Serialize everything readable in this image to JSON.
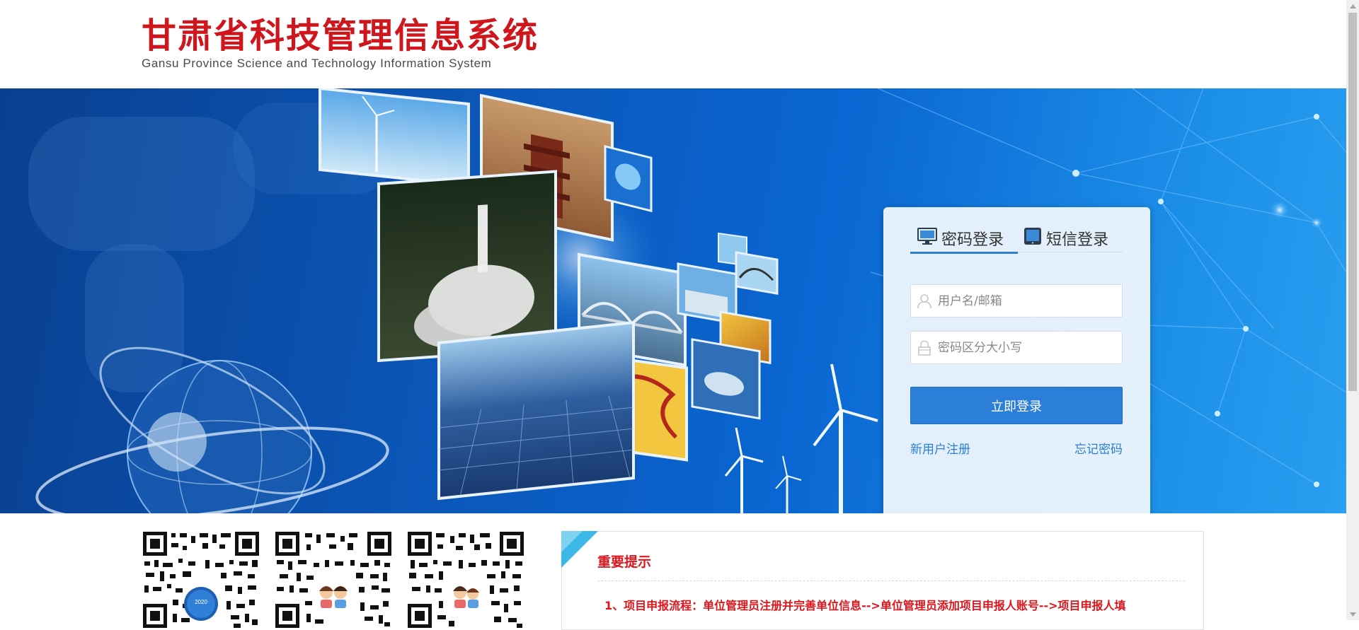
{
  "header": {
    "title_cn": "甘肃省科技管理信息系统",
    "title_en": "Gansu Province Science and Technology Information System"
  },
  "login": {
    "tabs": [
      {
        "label": "密码登录",
        "icon": "monitor-icon",
        "active": true
      },
      {
        "label": "短信登录",
        "icon": "tablet-icon",
        "active": false
      }
    ],
    "username": {
      "placeholder": "用户名/邮箱",
      "value": "",
      "icon": "user-icon"
    },
    "password": {
      "placeholder": "密码区分大小写",
      "value": "",
      "icon": "lock-icon"
    },
    "submit_label": "立即登录",
    "register_label": "新用户注册",
    "forgot_label": "忘记密码"
  },
  "qr_codes": [
    {
      "badge": "2020",
      "icon": "qr-code-icon"
    },
    {
      "icon": "qr-code-icon"
    },
    {
      "icon": "qr-code-icon"
    }
  ],
  "notice": {
    "title": "重要提示",
    "items": [
      "1、项目申报流程：单位管理员注册并完善单位信息-->单位管理员添加项目申报人账号-->项目申报人填"
    ]
  },
  "colors": {
    "brand_red": "#d0161d",
    "primary_blue": "#2b7fd8",
    "link_blue": "#2a7fd3",
    "notice_red": "#e0151c"
  }
}
